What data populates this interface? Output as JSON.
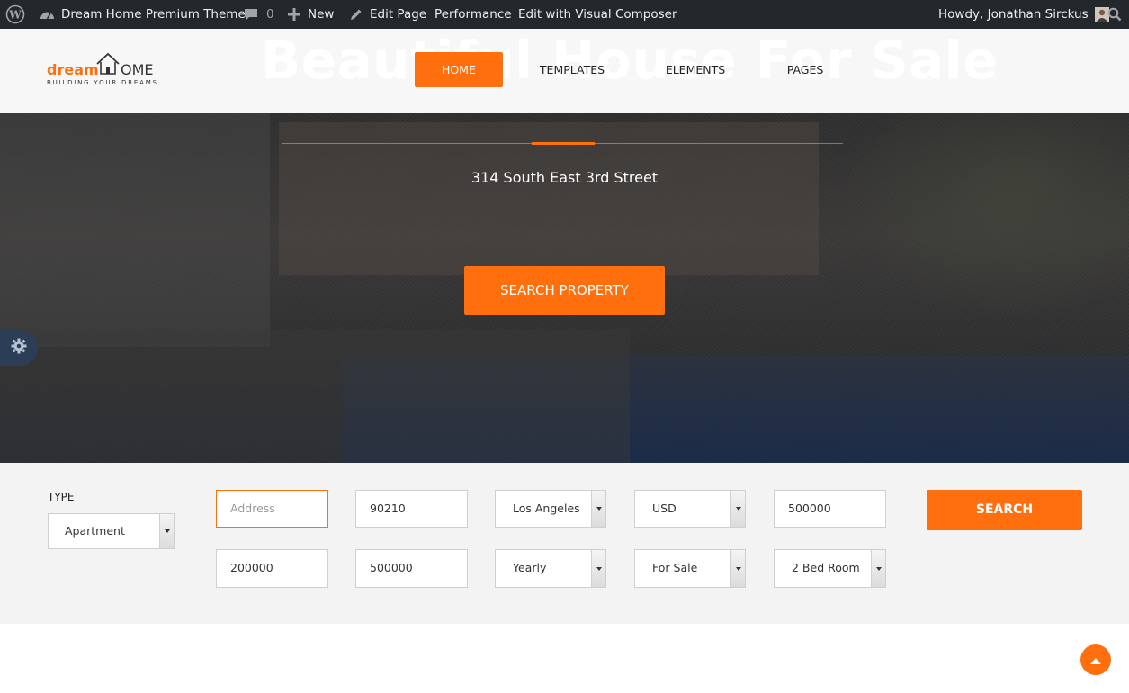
{
  "adminbar": {
    "site_name": "Dream Home Premium Theme",
    "comments_count": "0",
    "new_label": "New",
    "edit_label": "Edit Page",
    "performance_label": "Performance",
    "composer_label": "Edit with Visual Composer",
    "greeting": "Howdy, Jonathan Sirckus"
  },
  "header": {
    "ghost_title": "Beautiful House For Sale",
    "logo": {
      "word1": "dream",
      "word2": "OME",
      "tagline": "BUILDING YOUR DREAMS"
    },
    "nav": [
      "HOME",
      "TEMPLATES",
      "ELEMENTS",
      "PAGES"
    ]
  },
  "hero": {
    "address": "314 South East 3rd Street",
    "button": "SEARCH PROPERTY"
  },
  "search": {
    "type_label": "TYPE",
    "type_value": "Apartment",
    "address_placeholder": "Address",
    "zip": "90210",
    "city": "Los Angeles",
    "currency": "USD",
    "price_max": "500000",
    "price_min": "200000",
    "price_max2": "500000",
    "period": "Yearly",
    "status": "For Sale",
    "bedrooms": "2 Bed Room",
    "button": "SEARCH"
  },
  "colors": {
    "accent": "#ff6f0e",
    "adminbar": "#23282d",
    "panel": "#f3f3f3"
  }
}
